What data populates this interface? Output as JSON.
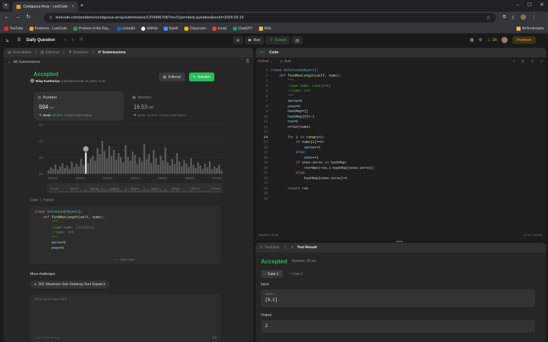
{
  "browser": {
    "tab_title": "Contiguous Array - LeetCode",
    "url": "leetcode.com/problems/contiguous-array/submissions/1204986708/?envType=daily-question&envId=2024-03-16",
    "bookmarks": [
      "YouTube",
      "Problems - LeetCode",
      "Problem of the Day...",
      "LinkedIn",
      "GitHub",
      "Byte8",
      "Classroom",
      "Gmail",
      "ChatGPT",
      "Web"
    ],
    "all_bookmarks": "All Bookmarks"
  },
  "nav": {
    "title": "Daily Question",
    "run": "Run",
    "submit": "Submit",
    "streak": "14",
    "premium": "Premium"
  },
  "left": {
    "tabs": [
      "Description",
      "Editorial",
      "Solutions",
      "Submissions"
    ],
    "all_submissions": "All Submissions",
    "status": "Accepted",
    "author": "Nilay Kanthariya",
    "submitted_at": "submitted at Mar 16, 2024 11:29",
    "editorial_btn": "Editorial",
    "solution_btn": "Solution",
    "runtime_label": "Runtime",
    "runtime_value": "594",
    "runtime_unit": "ms",
    "runtime_beats_label": "Beats",
    "runtime_beats": "99.37%",
    "runtime_beats_suffix": "of users with Python",
    "memory_label": "Memory",
    "memory_value": "16.53",
    "memory_unit": "MB",
    "memory_beats_label": "Beats",
    "memory_beats": "34.22%",
    "memory_beats_suffix": "of users with Python",
    "code_label": "Code",
    "code_lang": "Python",
    "view_more": "View more",
    "more_challenges": "More challenges",
    "challenge": "325. Maximum Size Subarray Sum Equals k",
    "notes_placeholder": "Write your notes here",
    "tags_placeholder": "Select related tags",
    "notes_count": "0/5"
  },
  "chart_data": {
    "type": "bar",
    "ylabels": [
      "6%",
      "4%",
      "2%",
      "0%"
    ],
    "xlabels": [
      "571ms",
      "580ms",
      "600ms",
      "620ms",
      "640ms",
      "660ms",
      "675ms"
    ],
    "range_labels": [
      "571ms",
      "583ms",
      "595ms",
      "608ms",
      "620ms",
      "632ms",
      "645ms",
      "657ms",
      "670ms"
    ],
    "values": [
      0.4,
      0.8,
      0.6,
      1.1,
      0.5,
      0.9,
      1.3,
      0.7,
      1.0,
      0.6,
      1.5,
      0.8,
      1.2,
      0.9,
      1.8,
      1.1,
      2.6,
      1.3,
      1.9,
      2.2,
      1.6,
      3.1,
      2.4,
      4.0,
      2.8,
      1.9,
      3.4,
      2.2,
      2.9,
      1.7,
      2.5,
      2.0,
      1.4,
      3.5,
      2.1,
      1.6,
      2.7,
      2.3,
      1.2,
      2.0,
      1.5,
      3.6,
      1.8,
      2.4,
      1.3,
      2.9,
      1.9,
      1.1,
      2.2,
      1.6,
      3.2,
      1.4,
      1.0,
      1.8,
      1.2,
      2.5,
      1.5,
      0.9,
      1.7,
      1.3,
      0.8,
      1.9,
      1.1,
      0.7,
      1.4,
      1.0,
      0.6,
      1.2,
      0.8,
      1.5,
      0.5,
      0.9,
      0.7,
      1.1,
      0.4
    ],
    "highlight_index": 16,
    "ylim": [
      0,
      6
    ]
  },
  "code_preview": [
    [
      [
        "kw",
        "class "
      ],
      [
        "ty",
        "Solution"
      ],
      [
        "",
        "("
      ],
      [
        "bi",
        "object"
      ],
      [
        "",
        "):"
      ]
    ],
    [
      [
        "",
        "    "
      ],
      [
        "kw",
        "def "
      ],
      [
        "fn",
        "findMaxLength"
      ],
      [
        "",
        "(self, nums):"
      ]
    ],
    [
      [
        "",
        "        "
      ],
      [
        "cm",
        "\"\"\""
      ]
    ],
    [
      [
        "",
        "        "
      ],
      [
        "cm",
        ":type nums: List[int]"
      ]
    ],
    [
      [
        "",
        "        "
      ],
      [
        "cm",
        ":rtype: int"
      ]
    ],
    [
      [
        "",
        "        "
      ],
      [
        "cm",
        "\"\"\""
      ]
    ],
    [
      [
        "",
        "        "
      ],
      [
        "vr",
        "zeros"
      ],
      [
        "",
        "="
      ],
      [
        "nm",
        "0"
      ]
    ],
    [
      [
        "",
        "        "
      ],
      [
        "vr",
        "ones"
      ],
      [
        "",
        "="
      ],
      [
        "nm",
        "0"
      ]
    ]
  ],
  "editor": {
    "title": "Code",
    "lang": "Python",
    "auto": "Auto",
    "saved": "Saved to local",
    "cursor": "Ln 14, Col 25",
    "lines": [
      [
        [
          "kw",
          "class "
        ],
        [
          "ty",
          "Solution"
        ],
        [
          "",
          "("
        ],
        [
          "bi",
          "object"
        ],
        [
          "",
          "):"
        ]
      ],
      [
        [
          "",
          "    "
        ],
        [
          "kw",
          "def "
        ],
        [
          "fn",
          "findMaxLength"
        ],
        [
          "",
          "(self, nums):"
        ]
      ],
      [
        [
          "",
          "        "
        ],
        [
          "cm",
          "\"\"\""
        ]
      ],
      [
        [
          "",
          "        "
        ],
        [
          "cm",
          ":type nums: List[int]"
        ]
      ],
      [
        [
          "",
          "        "
        ],
        [
          "cm",
          ":rtype: int"
        ]
      ],
      [
        [
          "",
          "        "
        ],
        [
          "cm",
          "\"\"\""
        ]
      ],
      [
        [
          "",
          "        "
        ],
        [
          "vr",
          "zeros"
        ],
        [
          "",
          "="
        ],
        [
          "nm",
          "0"
        ]
      ],
      [
        [
          "",
          "        "
        ],
        [
          "vr",
          "ones"
        ],
        [
          "",
          "="
        ],
        [
          "nm",
          "0"
        ]
      ],
      [
        [
          "",
          "        "
        ],
        [
          "vr",
          "hashMap"
        ],
        [
          "",
          "={}"
        ]
      ],
      [
        [
          "",
          "        "
        ],
        [
          "vr",
          "hashMap"
        ],
        [
          "",
          "["
        ],
        [
          "nm",
          "0"
        ],
        [
          "",
          "]=-"
        ],
        [
          "nm",
          "1"
        ]
      ],
      [
        [
          "",
          "        "
        ],
        [
          "vr",
          "res"
        ],
        [
          "",
          "="
        ],
        [
          "nm",
          "0"
        ]
      ],
      [
        [
          "",
          "        "
        ],
        [
          "vr",
          "n"
        ],
        [
          "",
          "="
        ],
        [
          "fn",
          "len"
        ],
        [
          "",
          "(nums)"
        ]
      ],
      [
        [
          "",
          ""
        ]
      ],
      [
        [
          "",
          "        "
        ],
        [
          "kw",
          "for "
        ],
        [
          "vr",
          "i"
        ],
        [
          "kw",
          " in "
        ],
        [
          "fn",
          "range"
        ],
        [
          "",
          "(n):"
        ]
      ],
      [
        [
          "",
          "            "
        ],
        [
          "kw",
          "if "
        ],
        [
          "",
          "nums[i]=="
        ],
        [
          "nm",
          "0"
        ],
        [
          "",
          ":"
        ]
      ],
      [
        [
          "",
          "                "
        ],
        [
          "vr",
          "zeros"
        ],
        [
          "",
          "+="
        ],
        [
          "nm",
          "1"
        ]
      ],
      [
        [
          "",
          "            "
        ],
        [
          "kw",
          "else"
        ],
        [
          "",
          ":"
        ]
      ],
      [
        [
          "",
          "                "
        ],
        [
          "vr",
          "ones"
        ],
        [
          "",
          "+="
        ],
        [
          "nm",
          "1"
        ]
      ],
      [
        [
          "",
          "            "
        ],
        [
          "kw",
          "if "
        ],
        [
          "",
          "ones-zeros "
        ],
        [
          "kw",
          "in "
        ],
        [
          "",
          "hashMap:"
        ]
      ],
      [
        [
          "",
          "                "
        ],
        [
          "vr",
          "res"
        ],
        [
          "",
          "="
        ],
        [
          "fn",
          "max"
        ],
        [
          "",
          "(res,i-hashMap[ones-zeros])"
        ]
      ],
      [
        [
          "",
          "            "
        ],
        [
          "kw",
          "else"
        ],
        [
          "",
          ":"
        ]
      ],
      [
        [
          "",
          "                "
        ],
        [
          "",
          "hashMap[ones-zeros]=i"
        ]
      ],
      [
        [
          "",
          ""
        ]
      ],
      [
        [
          "",
          "        "
        ],
        [
          "kw",
          "return "
        ],
        [
          "",
          "res"
        ]
      ],
      [
        [
          "",
          ""
        ]
      ],
      [
        [
          "",
          ""
        ]
      ]
    ]
  },
  "result": {
    "testcase_tab": "Testcase",
    "result_tab": "Test Result",
    "status": "Accepted",
    "runtime": "Runtime: 33 ms",
    "case1": "Case 1",
    "case2": "Case 2",
    "input_label": "Input",
    "input_var": "nums =",
    "input_value": "[0,1]",
    "output_label": "Output",
    "output_value": "2"
  }
}
